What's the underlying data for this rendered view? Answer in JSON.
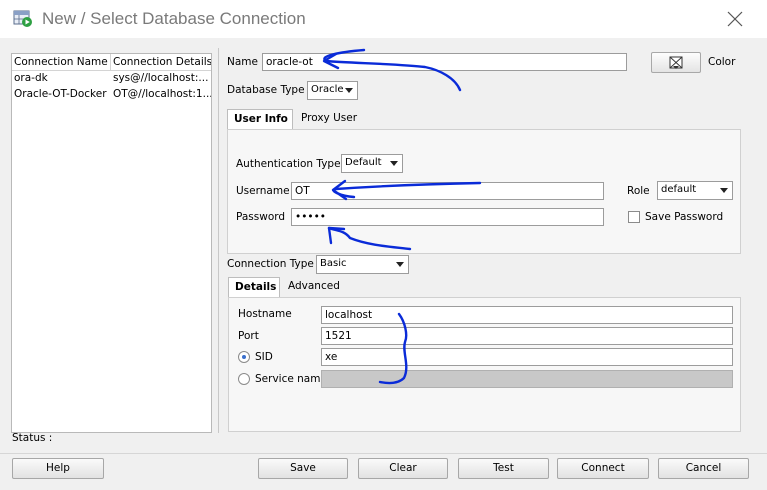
{
  "window": {
    "title": "New / Select Database Connection",
    "close_icon": "close-x-icon",
    "app_icon": "database-connection-icon"
  },
  "connections": {
    "headers": [
      "Connection Name",
      "Connection Details"
    ],
    "rows": [
      {
        "name": "ora-dk",
        "details": "sys@//localhost:..."
      },
      {
        "name": "Oracle-OT-Docker",
        "details": "OT@//localhost:1..."
      }
    ]
  },
  "form": {
    "name_label": "Name",
    "name_value": "oracle-ot",
    "color_label": "Color",
    "db_type_label": "Database Type",
    "db_type_value": "Oracle",
    "tabs": [
      "User Info",
      "Proxy User"
    ],
    "auth_type_label": "Authentication Type",
    "auth_type_value": "Default",
    "username_label": "Username",
    "username_value": "OT",
    "role_label": "Role",
    "role_value": "default",
    "password_label": "Password",
    "password_value": "•••••",
    "save_password_label": "Save Password",
    "save_password_checked": false,
    "conn_type_label": "Connection Type",
    "conn_type_value": "Basic",
    "detail_tabs": [
      "Details",
      "Advanced"
    ],
    "hostname_label": "Hostname",
    "hostname_value": "localhost",
    "port_label": "Port",
    "port_value": "1521",
    "sid_label": "SID",
    "sid_value": "xe",
    "sid_selected": true,
    "service_label": "Service name",
    "service_value": ""
  },
  "status_label": "Status :",
  "buttons": [
    "Help",
    "Save",
    "Clear",
    "Test",
    "Connect",
    "Cancel"
  ],
  "colors": {
    "annotation_ink": "#0a2bd8",
    "disabled_field": "#c8c8c8"
  }
}
